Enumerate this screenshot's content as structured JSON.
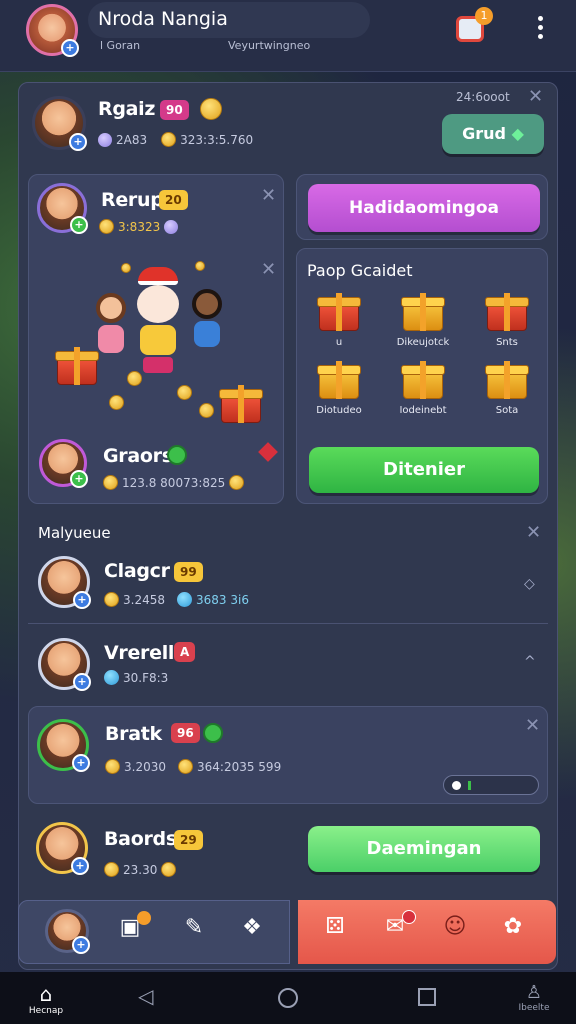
{
  "header": {
    "player_name": "Nroda Nangia",
    "status_line_1": "l  Goran",
    "status_line_2": "Veyurtwingneo",
    "notif_count": "1"
  },
  "top_card": {
    "name": "Rgaiz",
    "badge": "90",
    "stat_1": "2A83",
    "stat_2": "323:3:5.760",
    "meta": "24:6ooot",
    "button": "Grud"
  },
  "left_card": {
    "name": "Rerup",
    "badge": "20",
    "stat": "3:8323",
    "footer_name": "Graors",
    "footer_stat": "123.8 80073:825"
  },
  "purple_button": "Hadidaomingoa",
  "gift_panel": {
    "title": "Paop Gcaidet",
    "items": [
      {
        "label": "u",
        "color": "red"
      },
      {
        "label": "Dikeujotck",
        "color": "gold"
      },
      {
        "label": "Snts",
        "color": "red"
      },
      {
        "label": "Diotudeo",
        "color": "gold"
      },
      {
        "label": "Iodeinebt",
        "color": "gold"
      },
      {
        "label": "Sota",
        "color": "gold"
      }
    ],
    "button": "Ditenier"
  },
  "section_title": "Malyueue",
  "list": [
    {
      "name": "Clagcr",
      "badge": "99",
      "stat_1": "3.2458",
      "stat_2": "3683 3i6"
    },
    {
      "name": "Vrerello",
      "badge": "A",
      "stat_1": "30.F8:3"
    },
    {
      "name": "Bratk",
      "badge": "96",
      "stat_1": "3.2030",
      "stat_2": "364:2035 599"
    },
    {
      "name": "Baords",
      "badge": "29",
      "stat_1": "23.30",
      "button": "Daemingan"
    }
  ],
  "bottom_nav": {
    "home_label": "Hecnap",
    "profile_label": "Ibeelte"
  },
  "colors": {
    "green": "#3fc45a",
    "purple": "#c65ad8",
    "coral": "#f0675a",
    "teal": "#4e9a82"
  }
}
